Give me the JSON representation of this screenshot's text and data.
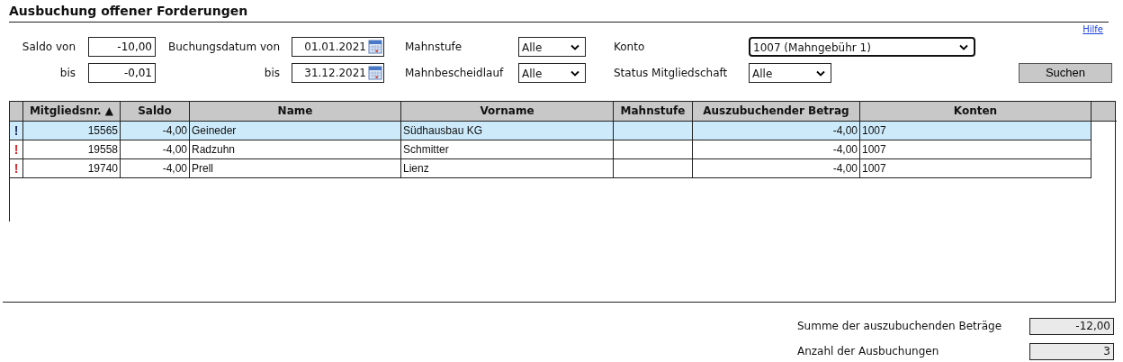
{
  "title": "Ausbuchung offener Forderungen",
  "help_link": "Hilfe",
  "filters": {
    "saldo": {
      "label_from": "Saldo von",
      "value_from": "-10,00",
      "label_to": "bis",
      "value_to": "-0,01"
    },
    "booking_date": {
      "label_from": "Buchungsdatum von",
      "value_from": "01.01.2021",
      "label_to": "bis",
      "value_to": "31.12.2021"
    },
    "mahnstufe": {
      "label": "Mahnstufe",
      "value": "Alle"
    },
    "mahnbescheidlauf": {
      "label": "Mahnbescheidlauf",
      "value": "Alle"
    },
    "konto": {
      "label": "Konto",
      "value": "1007 (Mahngebühr 1)"
    },
    "status": {
      "label": "Status Mitgliedschaft",
      "value": "Alle"
    }
  },
  "search_button": "Suchen",
  "table": {
    "columns": [
      "Mitgliedsnr. ▲",
      "Saldo",
      "Name",
      "Vorname",
      "Mahnstufe",
      "Auszubuchender Betrag",
      "Konten"
    ],
    "rows": [
      {
        "flag": "!",
        "selected": true,
        "cells": [
          "15565",
          "-4,00",
          "Geineder",
          "Südhausbau KG",
          "",
          "-4,00",
          "1007"
        ]
      },
      {
        "flag": "!",
        "selected": false,
        "cells": [
          "19558",
          "-4,00",
          "Radzuhn",
          "Schmitter",
          "",
          "-4,00",
          "1007"
        ]
      },
      {
        "flag": "!",
        "selected": false,
        "cells": [
          "19740",
          "-4,00",
          "Prell",
          "Lienz",
          "",
          "-4,00",
          "1007"
        ]
      }
    ]
  },
  "summary": [
    {
      "label": "Summe der auszubuchenden Beträge",
      "value": "-12,00"
    },
    {
      "label": "Anzahl der Ausbuchungen",
      "value": "3"
    }
  ]
}
